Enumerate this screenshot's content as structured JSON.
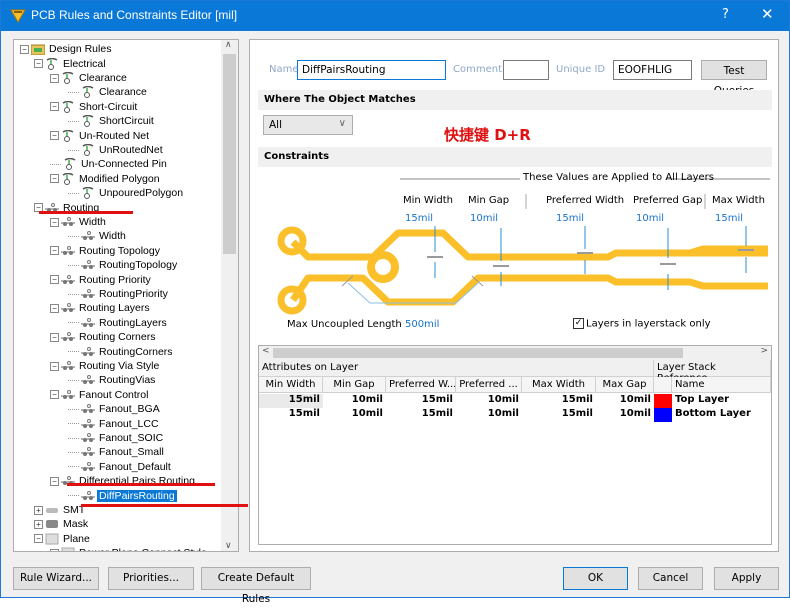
{
  "window": {
    "title": "PCB Rules and Constraints Editor [mil]",
    "help_label": "?",
    "close_label": "✕"
  },
  "tree": {
    "items": [
      {
        "label": "Design Rules",
        "level": 0,
        "expander": "−",
        "icon": "design-rules-folder-icon"
      },
      {
        "label": "Electrical",
        "level": 1,
        "expander": "−",
        "icon": "electrical-rule-icon"
      },
      {
        "label": "Clearance",
        "level": 2,
        "expander": "−",
        "icon": "electrical-rule-icon"
      },
      {
        "label": "Clearance",
        "level": 3,
        "expander": "",
        "icon": "electrical-rule-icon"
      },
      {
        "label": "Short-Circuit",
        "level": 2,
        "expander": "−",
        "icon": "electrical-rule-icon"
      },
      {
        "label": "ShortCircuit",
        "level": 3,
        "expander": "",
        "icon": "electrical-rule-icon"
      },
      {
        "label": "Un-Routed Net",
        "level": 2,
        "expander": "−",
        "icon": "electrical-rule-icon"
      },
      {
        "label": "UnRoutedNet",
        "level": 3,
        "expander": "",
        "icon": "electrical-rule-icon"
      },
      {
        "label": "Un-Connected Pin",
        "level": 2,
        "expander": "",
        "icon": "electrical-rule-icon"
      },
      {
        "label": "Modified Polygon",
        "level": 2,
        "expander": "−",
        "icon": "electrical-rule-icon"
      },
      {
        "label": "UnpouredPolygon",
        "level": 3,
        "expander": "",
        "icon": "electrical-rule-icon"
      },
      {
        "label": "Routing",
        "level": 1,
        "expander": "−",
        "icon": "routing-rule-icon"
      },
      {
        "label": "Width",
        "level": 2,
        "expander": "−",
        "icon": "routing-rule-icon"
      },
      {
        "label": "Width",
        "level": 3,
        "expander": "",
        "icon": "routing-rule-icon"
      },
      {
        "label": "Routing Topology",
        "level": 2,
        "expander": "−",
        "icon": "routing-rule-icon"
      },
      {
        "label": "RoutingTopology",
        "level": 3,
        "expander": "",
        "icon": "routing-rule-icon"
      },
      {
        "label": "Routing Priority",
        "level": 2,
        "expander": "−",
        "icon": "routing-rule-icon"
      },
      {
        "label": "RoutingPriority",
        "level": 3,
        "expander": "",
        "icon": "routing-rule-icon"
      },
      {
        "label": "Routing Layers",
        "level": 2,
        "expander": "−",
        "icon": "routing-rule-icon"
      },
      {
        "label": "RoutingLayers",
        "level": 3,
        "expander": "",
        "icon": "routing-rule-icon"
      },
      {
        "label": "Routing Corners",
        "level": 2,
        "expander": "−",
        "icon": "routing-rule-icon"
      },
      {
        "label": "RoutingCorners",
        "level": 3,
        "expander": "",
        "icon": "routing-rule-icon"
      },
      {
        "label": "Routing Via Style",
        "level": 2,
        "expander": "−",
        "icon": "routing-rule-icon"
      },
      {
        "label": "RoutingVias",
        "level": 3,
        "expander": "",
        "icon": "routing-rule-icon"
      },
      {
        "label": "Fanout Control",
        "level": 2,
        "expander": "−",
        "icon": "routing-rule-icon"
      },
      {
        "label": "Fanout_BGA",
        "level": 3,
        "expander": "",
        "icon": "routing-rule-icon"
      },
      {
        "label": "Fanout_LCC",
        "level": 3,
        "expander": "",
        "icon": "routing-rule-icon"
      },
      {
        "label": "Fanout_SOIC",
        "level": 3,
        "expander": "",
        "icon": "routing-rule-icon"
      },
      {
        "label": "Fanout_Small",
        "level": 3,
        "expander": "",
        "icon": "routing-rule-icon"
      },
      {
        "label": "Fanout_Default",
        "level": 3,
        "expander": "",
        "icon": "routing-rule-icon"
      },
      {
        "label": "Differential Pairs Routing",
        "level": 2,
        "expander": "−",
        "icon": "routing-rule-icon"
      },
      {
        "label": "DiffPairsRouting",
        "level": 3,
        "expander": "",
        "icon": "routing-rule-icon",
        "selected": true
      },
      {
        "label": "SMT",
        "level": 1,
        "expander": "+",
        "icon": "smt-rule-icon"
      },
      {
        "label": "Mask",
        "level": 1,
        "expander": "+",
        "icon": "mask-rule-icon"
      },
      {
        "label": "Plane",
        "level": 1,
        "expander": "−",
        "icon": "plane-rule-icon"
      },
      {
        "label": "Power Plane Connect Style",
        "level": 2,
        "expander": "+",
        "icon": "plane-rule-icon"
      }
    ]
  },
  "rule": {
    "name_label": "Name",
    "name_value": "DiffPairsRouting",
    "comment_label": "Comment",
    "comment_value": "",
    "unique_id_label": "Unique ID",
    "unique_id_value": "EOOFHLIG",
    "test_queries_label": "Test Queries",
    "where_section": "Where The Object Matches",
    "match_selected": "All",
    "annotation": "快捷键 D+R",
    "constraints_section": "Constraints"
  },
  "constraints": {
    "applied_label": "These Values are Applied to All Layers",
    "min_width_label": "Min Width",
    "min_width": "15mil",
    "min_gap_label": "Min Gap",
    "min_gap": "10mil",
    "pref_width_label": "Preferred Width",
    "pref_width": "15mil",
    "pref_gap_label": "Preferred Gap",
    "pref_gap": "10mil",
    "max_width_label": "Max Width",
    "max_width": "15mil",
    "max_uncoupled_label": "Max Uncoupled Length",
    "max_uncoupled": "500mil",
    "layers_only_label": "Layers in layerstack only",
    "layers_only_checked": true
  },
  "layer_table": {
    "group_attributes": "Attributes on Layer",
    "group_stack": "Layer Stack Reference",
    "columns": [
      "Min Width",
      "Min Gap",
      "Preferred W...",
      "Preferred ...",
      "Max Width",
      "Max Gap",
      "",
      "Name"
    ],
    "rows": [
      {
        "min_width": "15mil",
        "min_gap": "10mil",
        "pref_width": "15mil",
        "pref_gap": "10mil",
        "max_width": "15mil",
        "max_gap": "10mil",
        "color": "#ff0000",
        "name": "Top Layer"
      },
      {
        "min_width": "15mil",
        "min_gap": "10mil",
        "pref_width": "15mil",
        "pref_gap": "10mil",
        "max_width": "15mil",
        "max_gap": "10mil",
        "color": "#0000ff",
        "name": "Bottom Layer"
      }
    ]
  },
  "buttons": {
    "rule_wizard": "Rule Wizard...",
    "priorities": "Priorities...",
    "create_default": "Create Default Rules",
    "ok": "OK",
    "cancel": "Cancel",
    "apply": "Apply"
  },
  "colors": {
    "title_bar": "#0a78d7",
    "trace": "#fbbf2a",
    "annotation_red": "#e01010",
    "value_blue": "#1a73c9"
  }
}
